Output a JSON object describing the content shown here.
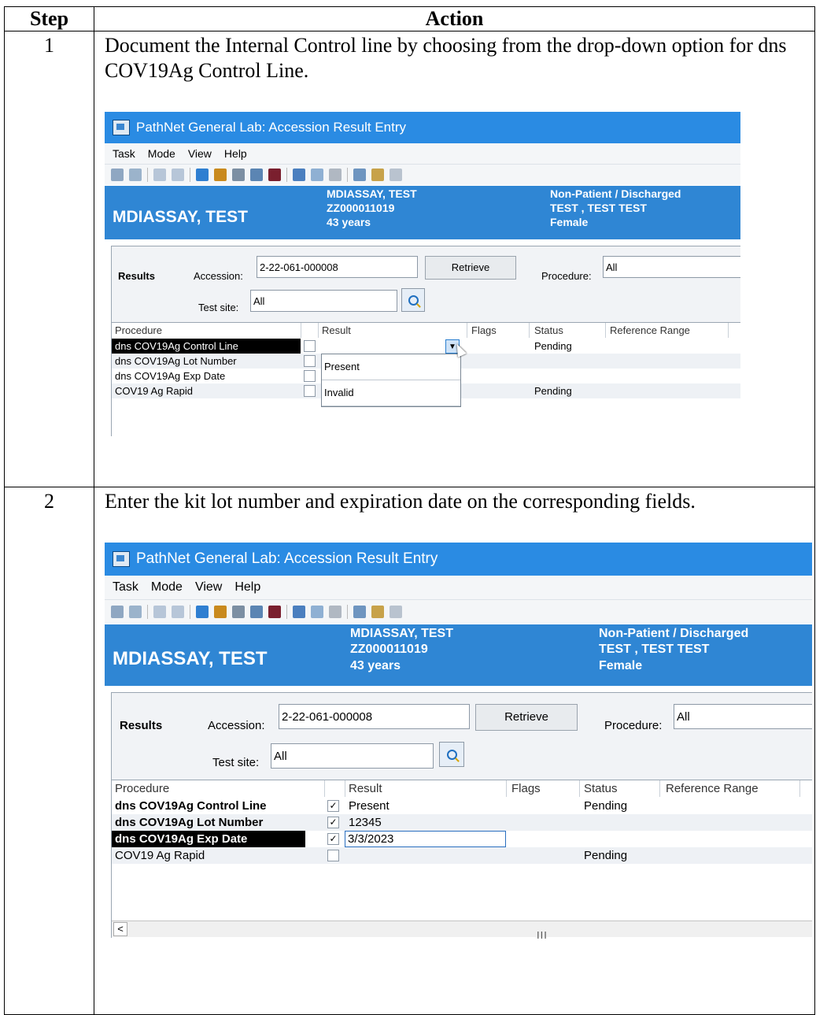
{
  "table": {
    "headers": [
      "Step",
      "Action"
    ],
    "rows": [
      {
        "step": "1",
        "text": "Document the Internal Control line by choosing from the drop-down option for dns COV19Ag Control Line."
      },
      {
        "step": "2",
        "text": "Enter the kit lot number and expiration date on the corresponding fields."
      }
    ]
  },
  "app": {
    "window_title": "PathNet General Lab: Accession Result Entry",
    "menu": [
      "Task",
      "Mode",
      "View",
      "Help"
    ],
    "patient": {
      "name": "MDIASSAY, TEST",
      "col2": [
        "MDIASSAY, TEST",
        "ZZ000011019",
        "43 years"
      ],
      "col3": [
        "Non-Patient / Discharged",
        "TEST , TEST TEST",
        "Female"
      ]
    },
    "results_label": "Results",
    "accession_label": "Accession:",
    "accession_value": "2-22-061-000008",
    "retrieve_label": "Retrieve",
    "procedure_label": "Procedure:",
    "procedure_value": "All",
    "test_site_label": "Test site:",
    "test_site_value": "All",
    "grid_columns": [
      "Procedure",
      "Result",
      "Flags",
      "Status",
      "Reference Range"
    ]
  },
  "screen1": {
    "rows": [
      {
        "procedure": "dns COV19Ag Control Line",
        "result": "",
        "status": "Pending"
      },
      {
        "procedure": "dns COV19Ag Lot Number",
        "result": "",
        "status": ""
      },
      {
        "procedure": "dns COV19Ag Exp Date",
        "result": "",
        "status": ""
      },
      {
        "procedure": "COV19 Ag Rapid",
        "result": "",
        "status": "Pending"
      }
    ],
    "dropdown_options": [
      "Present",
      "Invalid"
    ]
  },
  "screen2": {
    "rows": [
      {
        "procedure": "dns COV19Ag Control Line",
        "result": "Present",
        "status": "Pending",
        "checked": "✓"
      },
      {
        "procedure": "dns COV19Ag Lot Number",
        "result": "12345",
        "status": "",
        "checked": "✓"
      },
      {
        "procedure": "dns COV19Ag Exp Date",
        "result": "3/3/2023",
        "status": "",
        "checked": "✓"
      },
      {
        "procedure": "COV19 Ag Rapid",
        "result": "",
        "status": "Pending",
        "checked": ""
      }
    ],
    "scrollbar_left": "<",
    "scrollbar_grip": "III"
  },
  "colors": {
    "title_bar": "#2a8be3",
    "patient_banner": "#2f86d4",
    "selection": "#000000"
  }
}
